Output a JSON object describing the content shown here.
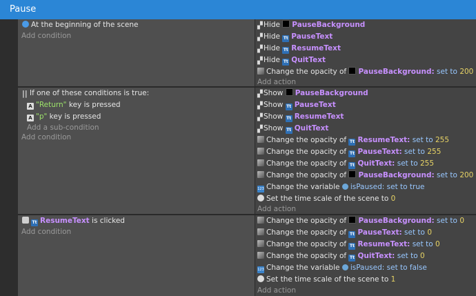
{
  "header": {
    "title": "Pause"
  },
  "events": [
    {
      "conditions": [
        {
          "icon": "scene-start-icon",
          "text": "At the beginning of the scene"
        }
      ],
      "add_condition": "Add condition",
      "actions": [
        {
          "type": "hide",
          "icon": "hide-icon",
          "verb": "Hide",
          "obj_icon": "sprite-icon",
          "object": "PauseBackground"
        },
        {
          "type": "hide",
          "icon": "hide-icon",
          "verb": "Hide",
          "obj_icon": "text-object-icon",
          "object": "PauseText"
        },
        {
          "type": "hide",
          "icon": "hide-icon",
          "verb": "Hide",
          "obj_icon": "text-object-icon",
          "object": "ResumeText"
        },
        {
          "type": "hide",
          "icon": "hide-icon",
          "verb": "Hide",
          "obj_icon": "text-object-icon",
          "object": "QuitText"
        },
        {
          "type": "opacity",
          "icon": "opacity-icon",
          "prefix": "Change the opacity of",
          "obj_icon": "sprite-icon",
          "object": "PauseBackground:",
          "op": "set to",
          "value": "200"
        }
      ],
      "add_action": "Add action"
    },
    {
      "conditions": [
        {
          "icon": "or-icon",
          "text": "If one of these conditions is true:"
        },
        {
          "icon": "keyboard-icon",
          "key": "\"Return\"",
          "text": "key is pressed",
          "indent": true
        },
        {
          "icon": "keyboard-icon",
          "key": "\"p\"",
          "text": "key is pressed",
          "indent": true
        }
      ],
      "add_subcondition": "Add a sub-condition",
      "add_condition": "Add condition",
      "actions": [
        {
          "type": "show",
          "verb": "Show",
          "obj_icon": "sprite-icon",
          "object": "PauseBackground"
        },
        {
          "type": "show",
          "verb": "Show",
          "obj_icon": "text-object-icon",
          "object": "PauseText"
        },
        {
          "type": "show",
          "verb": "Show",
          "obj_icon": "text-object-icon",
          "object": "ResumeText"
        },
        {
          "type": "show",
          "verb": "Show",
          "obj_icon": "text-object-icon",
          "object": "QuitText"
        },
        {
          "type": "opacity",
          "prefix": "Change the opacity of",
          "obj_icon": "text-object-icon",
          "object": "ResumeText:",
          "op": "set to",
          "value": "255"
        },
        {
          "type": "opacity",
          "prefix": "Change the opacity of",
          "obj_icon": "text-object-icon",
          "object": "PauseText:",
          "op": "set to",
          "value": "255"
        },
        {
          "type": "opacity",
          "prefix": "Change the opacity of",
          "obj_icon": "text-object-icon",
          "object": "QuitText:",
          "op": "set to",
          "value": "255"
        },
        {
          "type": "opacity",
          "prefix": "Change the opacity of",
          "obj_icon": "sprite-icon",
          "object": "PauseBackground:",
          "op": "set to",
          "value": "200"
        },
        {
          "type": "variable",
          "prefix": "Change the variable",
          "var": "isPaused:",
          "op": "set to true"
        },
        {
          "type": "timescale",
          "prefix": "Set the time scale of the scene to",
          "value": "0"
        }
      ],
      "add_action": "Add action"
    },
    {
      "conditions": [
        {
          "icon": "mouse-icon",
          "object": "ResumeText",
          "text": "is clicked"
        }
      ],
      "add_condition": "Add condition",
      "actions": [
        {
          "type": "opacity",
          "prefix": "Change the opacity of",
          "obj_icon": "sprite-icon",
          "object": "PauseBackground:",
          "op": "set to",
          "value": "0"
        },
        {
          "type": "opacity",
          "prefix": "Change the opacity of",
          "obj_icon": "text-object-icon",
          "object": "PauseText:",
          "op": "set to",
          "value": "0"
        },
        {
          "type": "opacity",
          "prefix": "Change the opacity of",
          "obj_icon": "text-object-icon",
          "object": "ResumeText:",
          "op": "set to",
          "value": "0"
        },
        {
          "type": "opacity",
          "prefix": "Change the opacity of",
          "obj_icon": "text-object-icon",
          "object": "QuitText:",
          "op": "set to",
          "value": "0"
        },
        {
          "type": "variable",
          "prefix": "Change the variable",
          "var": "isPaused:",
          "op": "set to false"
        },
        {
          "type": "timescale",
          "prefix": "Set the time scale of the scene to",
          "value": "1"
        }
      ],
      "add_action": "Add action"
    }
  ]
}
